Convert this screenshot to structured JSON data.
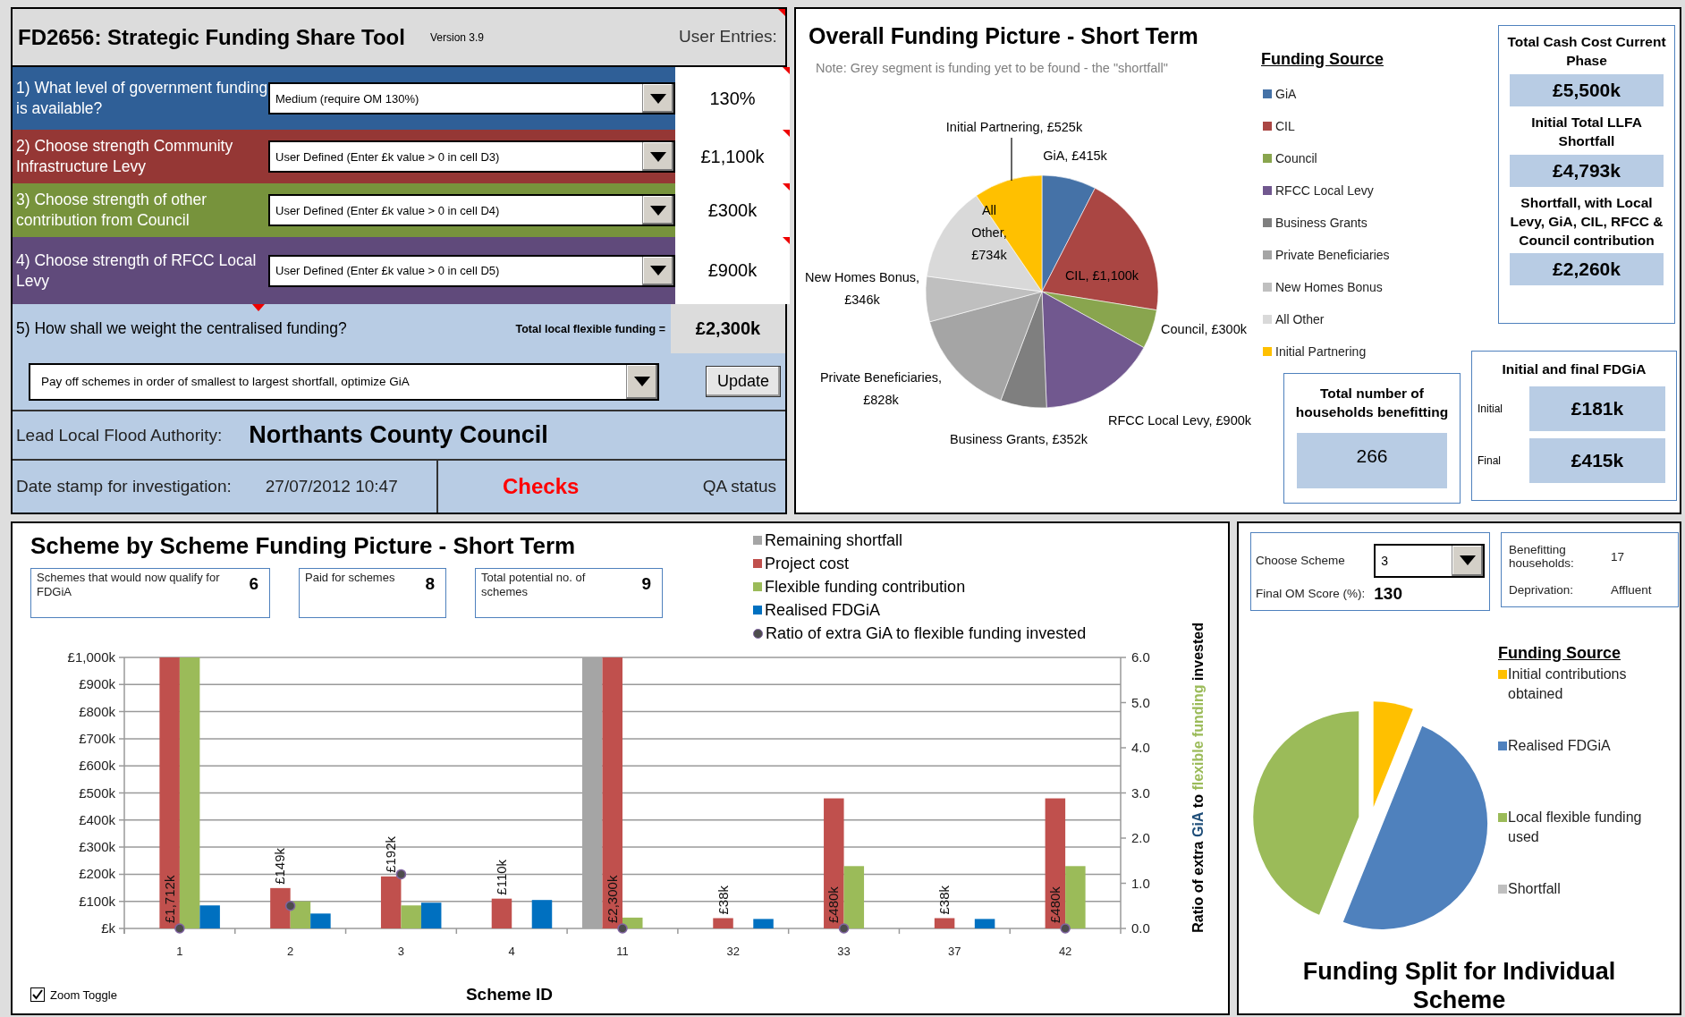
{
  "tool": {
    "title": "FD2656: Strategic Funding Share Tool",
    "version": "Version 3.9",
    "entries_heading": "User Entries:",
    "heading_comment": true,
    "questions": [
      {
        "label": "1) What level of government funding is available?",
        "color": "#2f5f97",
        "choice": "Medium (require OM 130%)",
        "entry": "130%",
        "comment": true
      },
      {
        "label": "2) Choose strength Community Infrastructure Levy",
        "color": "#953735",
        "choice": "User Defined (Enter £k value > 0 in cell D3)",
        "entry": "£1,100k",
        "comment": true
      },
      {
        "label": "3) Choose strength of other contribution from Council",
        "color": "#77933c",
        "choice": "User Defined (Enter £k value > 0 in cell D4)",
        "entry": "£300k",
        "comment": true
      },
      {
        "label": "4) Choose strength of RFCC Local Levy",
        "color": "#604a7b",
        "choice": "User Defined (Enter £k value > 0 in cell D5)",
        "entry": "£900k",
        "comment": true
      }
    ],
    "weighting": {
      "label": "5) How shall we weight the centralised funding?",
      "comment": true,
      "total_label": "Total local flexible funding =",
      "total": "£2,300k",
      "choice": "Pay off schemes in order of smallest to largest shortfall, optimize GiA",
      "button": "Update"
    },
    "authority": {
      "label": "Lead Local Flood Authority:",
      "value": "Northants County Council"
    },
    "date_stamp": {
      "label": "Date stamp for investigation:",
      "value": "27/07/2012 10:47"
    },
    "checks": "Checks",
    "qa_status": "QA status"
  },
  "overview": {
    "note": "Note: Grey segment is funding yet to be found - the \"shortfall\"",
    "chart_data": {
      "type": "pie",
      "title": "Overall Funding Picture - Short Term",
      "categories": [
        "GiA",
        "CIL",
        "Council",
        "RFCC Local Levy",
        "Business Grants",
        "Private Beneficiaries",
        "New Homes Bonus",
        "All Other",
        "Initial Partnering"
      ],
      "values": [
        415,
        1100,
        300,
        900,
        352,
        828,
        346,
        734,
        525
      ],
      "value_labels": [
        "GiA, £415k",
        "CIL, £1,100k",
        "Council, £300k",
        "RFCC Local Levy, £900k",
        "Business Grants, £352k",
        "Private Beneficiaries, £828k",
        "New Homes Bonus, £346k",
        "All Other, £734k",
        "Initial Partnering, £525k"
      ]
    },
    "legend": {
      "title": "Funding Source",
      "items": [
        {
          "color": "#4572a7"
        },
        {
          "color": "#aa4643"
        },
        {
          "color": "#89a54e"
        },
        {
          "color": "#71588f"
        },
        {
          "color": "#7f7f7f"
        },
        {
          "color": "#a5a5a5"
        },
        {
          "color": "#bfbfbf"
        },
        {
          "color": "#d9d9d9"
        },
        {
          "color": "#ffc000"
        }
      ]
    },
    "totals": [
      {
        "label": "Total Cash Cost Current Phase",
        "value": "£5,500k"
      },
      {
        "label": "Initial  Total LLFA Shortfall",
        "value": "£4,793k"
      },
      {
        "label": "Shortfall, with Local Levy, GiA, CIL, RFCC & Council contribution",
        "value": "£2,260k"
      }
    ],
    "households": {
      "label": "Total number of households benefitting",
      "value": "266"
    },
    "fdgia": {
      "title": "Initial and final FDGiA",
      "rows": [
        {
          "label": "Initial",
          "value": "£181k"
        },
        {
          "label": "Final",
          "value": "£415k"
        }
      ]
    }
  },
  "schemes": {
    "stats": [
      {
        "label": "Schemes that would now qualify for FDGiA",
        "value": "6"
      },
      {
        "label": "Paid for schemes",
        "value": "8"
      },
      {
        "label": "Total potential no. of schemes",
        "value": "9"
      }
    ],
    "chart_data": {
      "type": "bar",
      "title": "Scheme by Scheme Funding Picture - Short Term",
      "xlabel": "Scheme ID",
      "categories": [
        "1",
        "2",
        "3",
        "4",
        "11",
        "32",
        "33",
        "37",
        "42"
      ],
      "ylim": [
        0,
        1000
      ],
      "grid": true,
      "legend": "upper right",
      "annotations": [
        {
          "x": "1",
          "y": 0,
          "text": "£1,712k"
        },
        {
          "x": "11",
          "y": 0,
          "text": "£2,300k"
        }
      ],
      "yticks": [
        {
          "value": 0,
          "label": "£k"
        },
        {
          "value": 100,
          "label": "£100k"
        },
        {
          "value": 200,
          "label": "£200k"
        },
        {
          "value": 300,
          "label": "£300k"
        },
        {
          "value": 400,
          "label": "£400k"
        },
        {
          "value": 500,
          "label": "£500k"
        },
        {
          "value": 600,
          "label": "£600k"
        },
        {
          "value": 700,
          "label": "£700k"
        },
        {
          "value": 800,
          "label": "£800k"
        },
        {
          "value": 900,
          "label": "£900k"
        },
        {
          "value": 1000,
          "label": "£1,000k"
        }
      ],
      "y2lim": [
        0,
        6
      ],
      "y2ticks": [
        {
          "value": 0,
          "label": "0.0"
        },
        {
          "value": 1,
          "label": "1.0"
        },
        {
          "value": 2,
          "label": "2.0"
        },
        {
          "value": 3,
          "label": "3.0"
        },
        {
          "value": 4,
          "label": "4.0"
        },
        {
          "value": 5,
          "label": "5.0"
        },
        {
          "value": 6,
          "label": "6.0"
        }
      ],
      "y2label": [
        {
          "text": "Ratio of extra ",
          "color": "#000000"
        },
        {
          "text": "GiA",
          "color": "#1f4e79"
        },
        {
          "text": " to ",
          "color": "#000000"
        },
        {
          "text": "flexible funding",
          "color": "#9bbb59"
        },
        {
          "text": " invested",
          "color": "#000000"
        }
      ],
      "series": [
        {
          "name": "Remaining shortfall",
          "color": "#a5a5a5",
          "values": [
            0,
            0,
            0,
            0,
            1000,
            0,
            0,
            0,
            0
          ]
        },
        {
          "name": "Project cost",
          "color": "#c0504d",
          "values": [
            1000,
            149,
            192,
            110,
            1000,
            38,
            480,
            38,
            480
          ],
          "value_labels": [
            null,
            "£149k",
            "£192k",
            "£110k",
            null,
            "£38k",
            "£480k",
            "£38k",
            "£480k"
          ]
        },
        {
          "name": "Flexible funding contribution",
          "color": "#9bbb59",
          "values": [
            1000,
            100,
            85,
            0,
            40,
            0,
            230,
            0,
            230
          ]
        },
        {
          "name": "Realised FDGiA",
          "color": "#0070c0",
          "values": [
            85,
            55,
            95,
            105,
            0,
            35,
            0,
            35,
            0
          ]
        },
        {
          "name": "Ratio of extra GiA to flexible funding invested",
          "color": "#4d4d4d",
          "type": "scatter",
          "axis": "y2",
          "values": [
            0,
            0.5,
            1.2,
            null,
            0,
            null,
            0,
            null,
            0
          ]
        }
      ]
    },
    "zoom_toggle": {
      "label": "Zoom Toggle",
      "checked": true
    }
  },
  "scheme_detail": {
    "choose_label": "Choose Scheme",
    "choice": "3",
    "score_label": "Final OM Score (%):",
    "score": "130",
    "households_label": "Benefitting households:",
    "households": "17",
    "deprivation_label": "Deprivation:",
    "deprivation": "Affluent",
    "legend": {
      "title": "Funding Source",
      "items": [
        {
          "label": "Initial contributions obtained",
          "color": "#ffc000"
        },
        {
          "label": "Realised FDGiA",
          "color": "#4f81bd"
        },
        {
          "label": "Local flexible funding used",
          "color": "#9bbb59"
        },
        {
          "label": "Shortfall",
          "color": "#bfbfbf"
        }
      ]
    },
    "title": "Funding Split for Individual Scheme"
  }
}
